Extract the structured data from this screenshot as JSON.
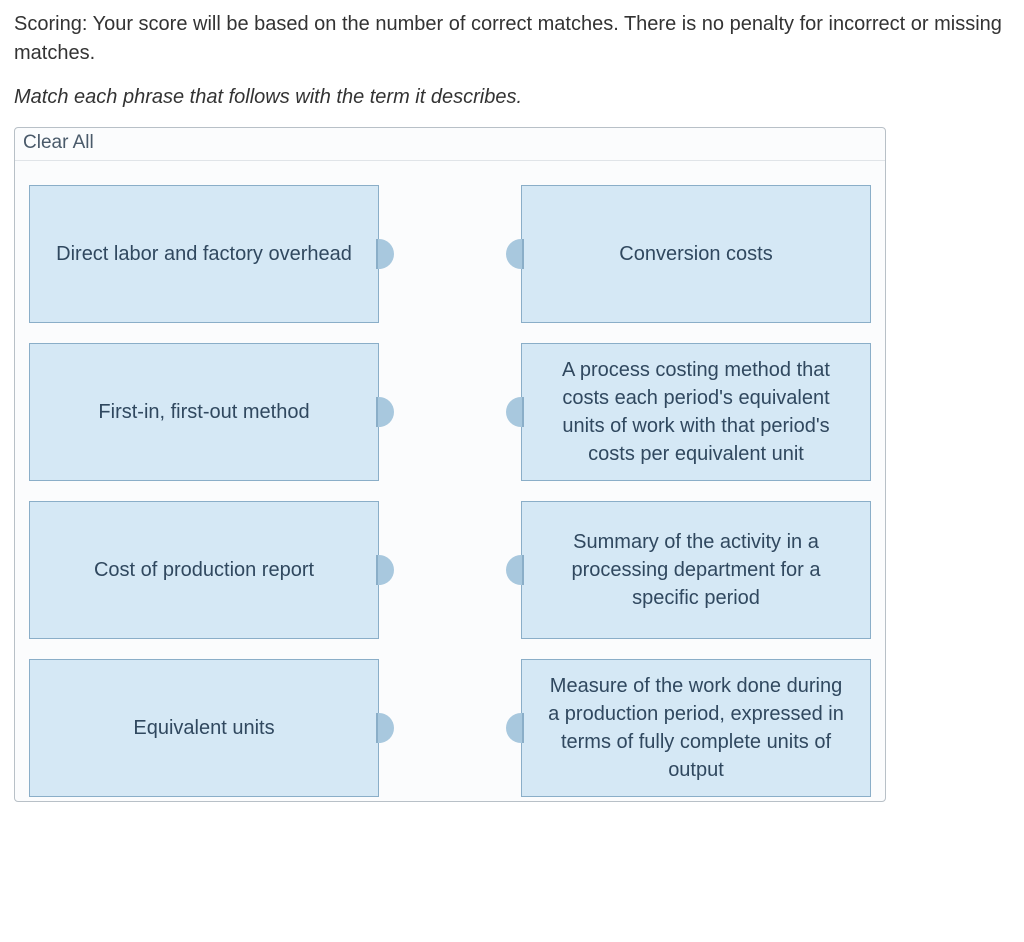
{
  "scoring_text": "Scoring: Your score will be based on the number of correct matches. There is no penalty for incorrect or missing matches.",
  "instructions_text": "Match each phrase that follows with the term it describes.",
  "clear_all_label": "Clear All",
  "left_items": [
    {
      "label": "Direct labor and factory overhead"
    },
    {
      "label": "First-in, first-out method"
    },
    {
      "label": "Cost of production report"
    },
    {
      "label": "Equivalent units"
    }
  ],
  "right_items": [
    {
      "label": "Conversion costs"
    },
    {
      "label": "A process costing method that costs each period's equivalent units of work with that period's costs per equivalent unit"
    },
    {
      "label": "Summary of the activity in a processing department for a specific period"
    },
    {
      "label": "Measure of the work done during a production period, expressed in terms of fully complete units of output"
    }
  ]
}
